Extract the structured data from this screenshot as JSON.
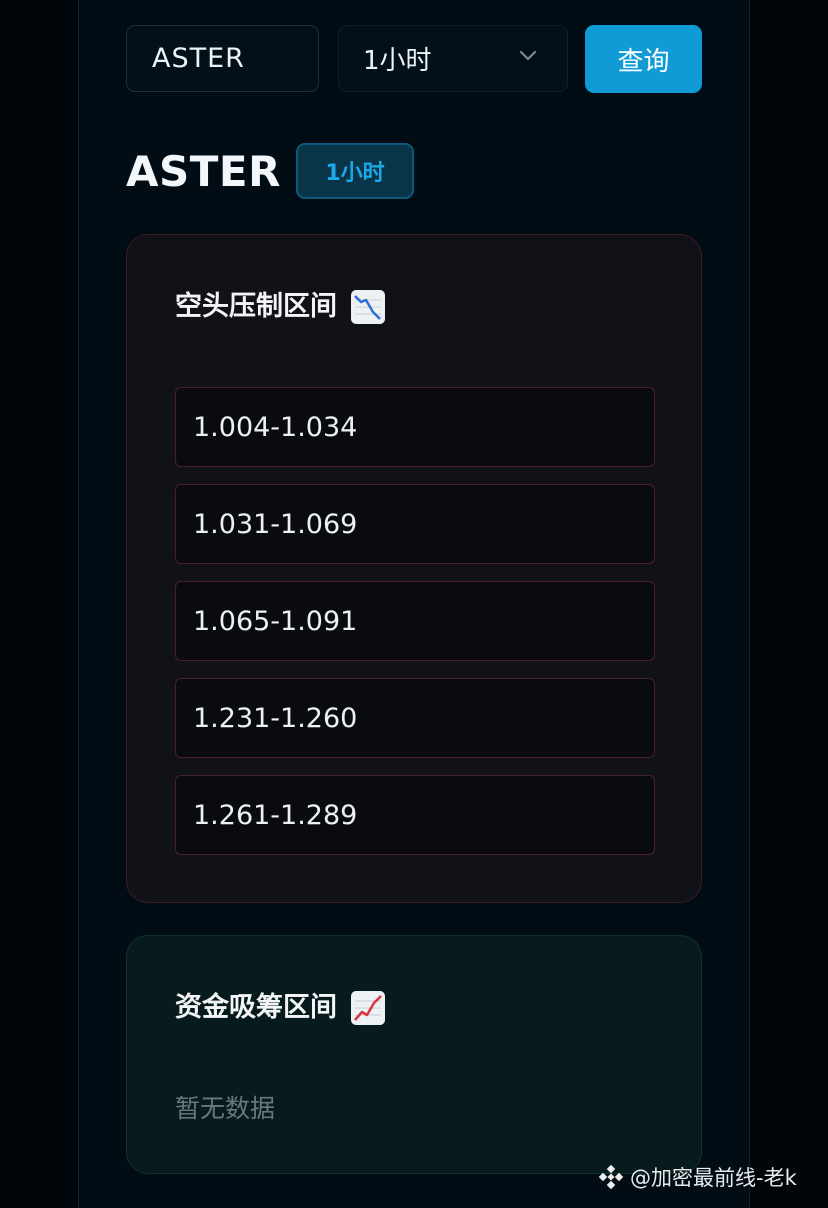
{
  "query_bar": {
    "symbol_value": "ASTER",
    "interval_selected": "1小时",
    "query_label": "查询"
  },
  "result": {
    "symbol": "ASTER",
    "interval": "1小时"
  },
  "bear_zone": {
    "title": "空头压制区间",
    "icon": "chart-decreasing-icon",
    "ranges": [
      "1.004-1.034",
      "1.031-1.069",
      "1.065-1.091",
      "1.231-1.260",
      "1.261-1.289"
    ]
  },
  "bull_zone": {
    "title": "资金吸筹区间",
    "icon": "chart-increasing-icon",
    "empty_text": "暂无数据"
  },
  "watermark": {
    "text": "@加密最前线-老k",
    "icon": "binance-logo-icon"
  },
  "colors": {
    "accent": "#109bd6",
    "bear_border": "#4a2028",
    "bull_background": "#071b1e"
  }
}
